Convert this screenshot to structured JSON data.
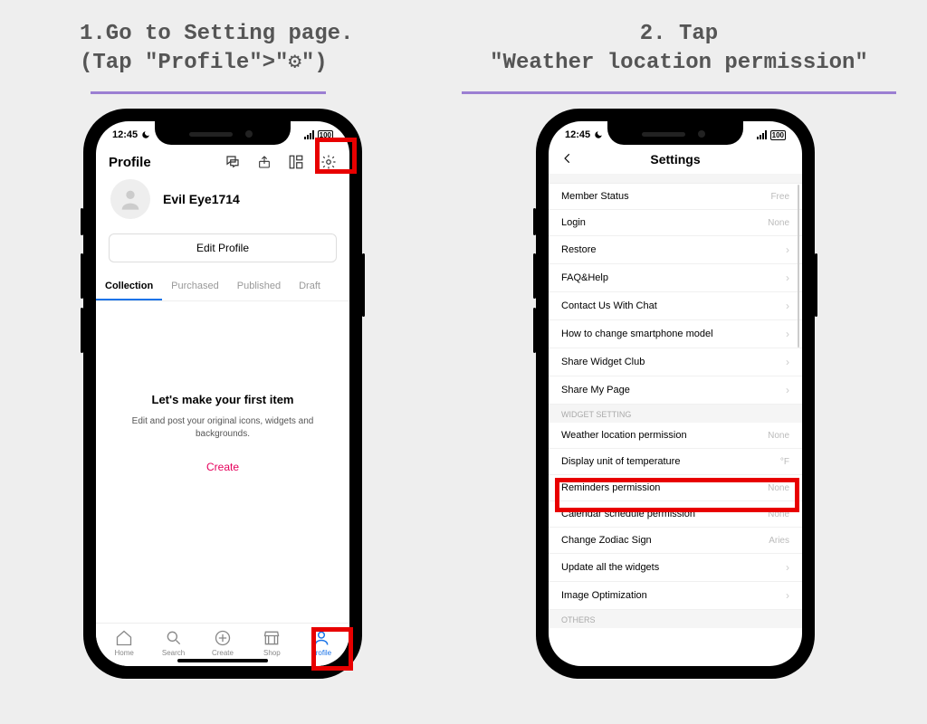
{
  "step1": {
    "line1": "1.Go to Setting page.",
    "line2": "(Tap \"Profile\">\"⚙\")"
  },
  "step2": {
    "line1": "2. Tap",
    "line2": "\"Weather location permission\""
  },
  "statusbar": {
    "time": "12:45",
    "battery_label": "100"
  },
  "phone1": {
    "header_title": "Profile",
    "username": "Evil Eye1714",
    "edit_btn": "Edit Profile",
    "tabs": {
      "collection": "Collection",
      "purchased": "Purchased",
      "published": "Published",
      "draft": "Draft"
    },
    "body": {
      "title": "Let's make your first item",
      "sub": "Edit and post your original icons, widgets and backgrounds.",
      "create": "Create"
    },
    "tabbar": {
      "home": "Home",
      "search": "Search",
      "create": "Create",
      "shop": "Shop",
      "profile": "Profile"
    }
  },
  "phone2": {
    "nav_title": "Settings",
    "rows": {
      "member_status": {
        "label": "Member Status",
        "value": "Free"
      },
      "login": {
        "label": "Login",
        "value": "None"
      },
      "restore": {
        "label": "Restore"
      },
      "faq": {
        "label": "FAQ&Help"
      },
      "contact": {
        "label": "Contact Us With Chat"
      },
      "change_model": {
        "label": "How to change smartphone model"
      },
      "share_app": {
        "label": "Share Widget Club"
      },
      "share_page": {
        "label": "Share My Page"
      }
    },
    "group_widget_label": "WIDGET SETTING",
    "widget_rows": {
      "weather": {
        "label": "Weather location permission",
        "value": "None"
      },
      "temp_unit": {
        "label": "Display unit of temperature",
        "value": "°F"
      },
      "reminders": {
        "label": "Reminders permission",
        "value": "None"
      },
      "calendar": {
        "label": "Calendar schedule permission",
        "value": "None"
      },
      "zodiac": {
        "label": "Change Zodiac Sign",
        "value": "Aries"
      },
      "update_all": {
        "label": "Update all the widgets"
      },
      "image_opt": {
        "label": "Image Optimization"
      }
    },
    "group_others_label": "OTHERS"
  }
}
